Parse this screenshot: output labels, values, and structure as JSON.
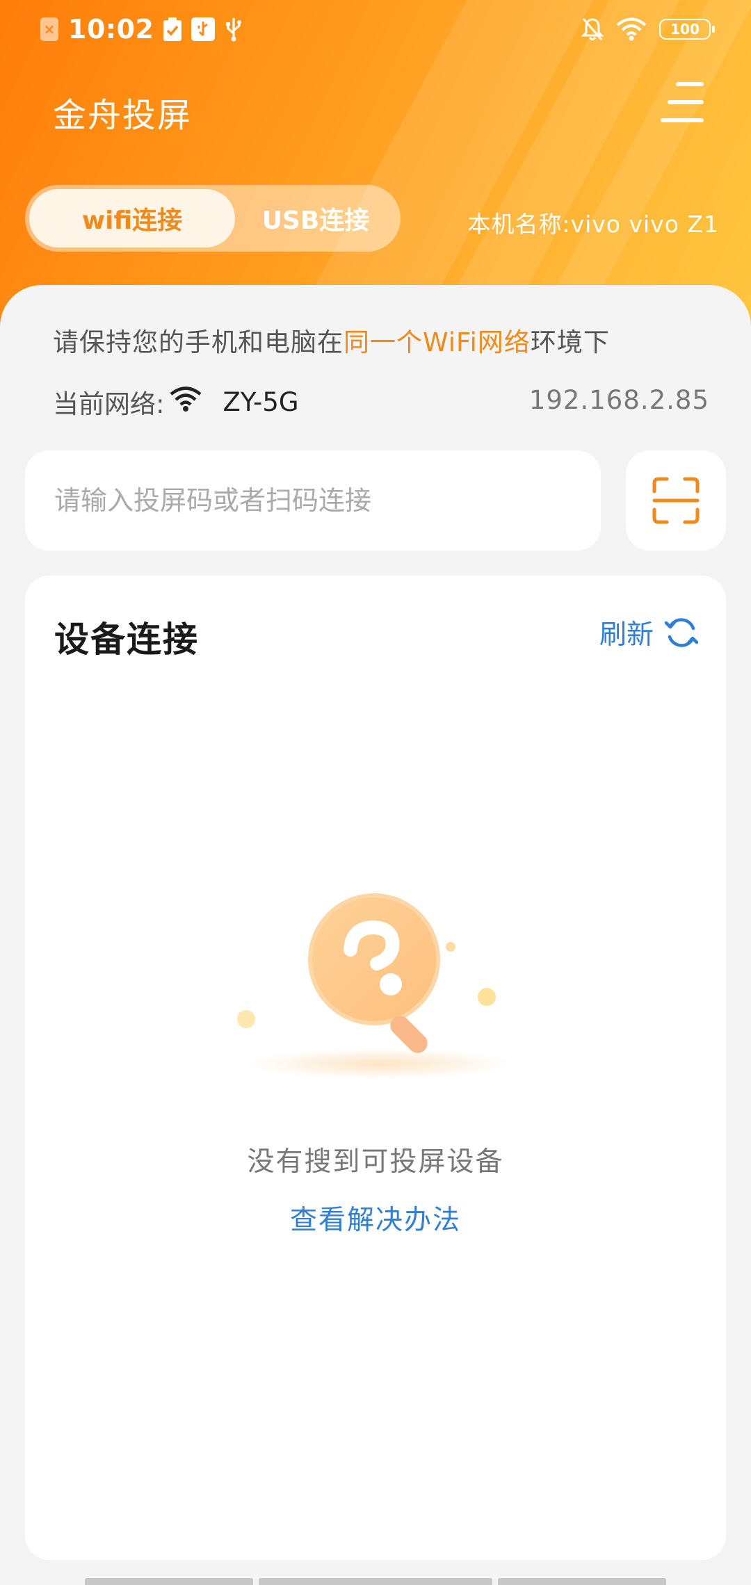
{
  "status_bar": {
    "time": "10:02",
    "battery": "100",
    "icons": [
      "app-notification-icon",
      "checklist-icon",
      "usb-debug-icon",
      "usb-icon",
      "silent-bell-icon",
      "wifi-icon",
      "battery-icon"
    ]
  },
  "header": {
    "title": "金舟投屏",
    "menu_icon": "menu-icon"
  },
  "tabs": {
    "wifi_label": "wifi连接",
    "usb_label": "USB连接",
    "selected": "wifi连接"
  },
  "device_name": "本机名称:vivo  vivo Z1",
  "tip": {
    "before": "请保持您的手机和电脑在",
    "highlight": "同一个WiFi网络",
    "after": "环境下"
  },
  "network": {
    "label": "当前网络:",
    "name": "ZY-5G",
    "ip": "192.168.2.85"
  },
  "code_input": {
    "placeholder": "请输入投屏码或者扫码连接",
    "value": ""
  },
  "device_section": {
    "title": "设备连接",
    "refresh_label": "刷新",
    "empty_text": "没有搜到可投屏设备",
    "help_link": "查看解决办法"
  },
  "colors": {
    "accent_orange": "#f08a1c",
    "link_blue": "#2f7fd6",
    "header_gradient_start": "#ff7d0a",
    "header_gradient_end": "#ffc640"
  }
}
